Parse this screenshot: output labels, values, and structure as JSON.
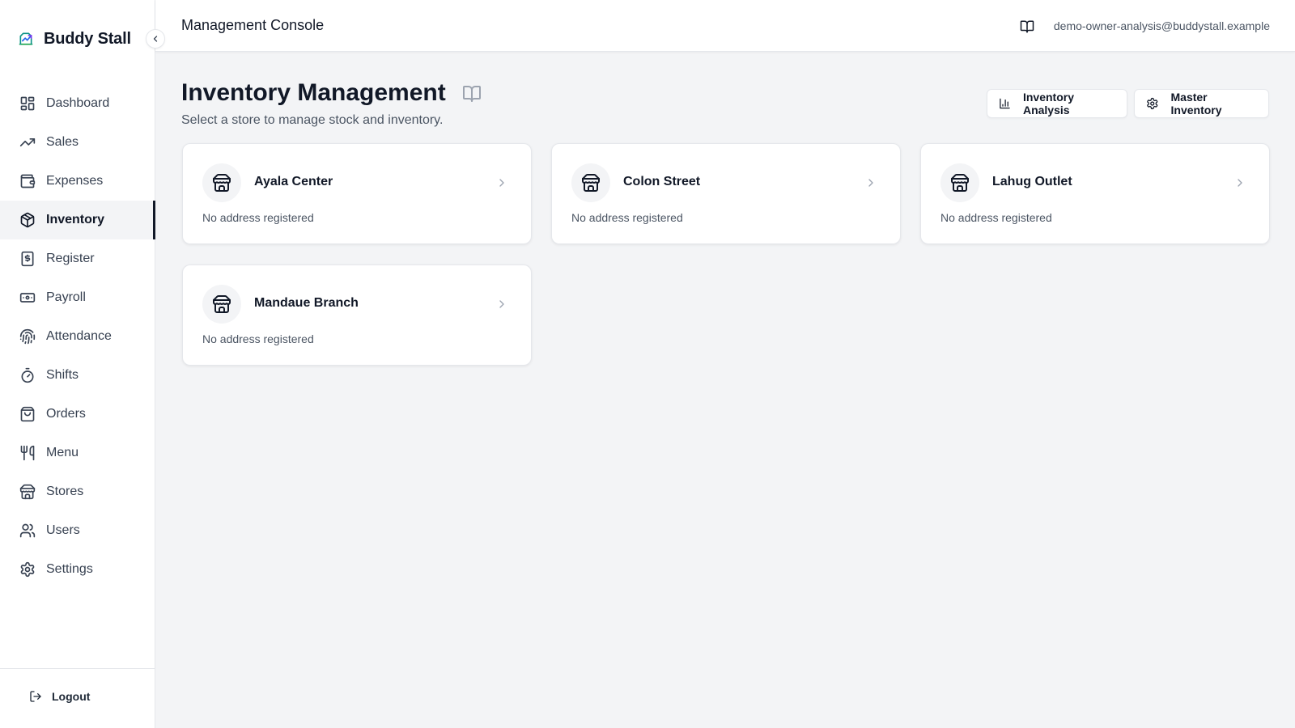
{
  "brand": {
    "name": "Buddy Stall"
  },
  "sidebar": {
    "items": [
      {
        "label": "Dashboard",
        "icon": "dashboard-icon"
      },
      {
        "label": "Sales",
        "icon": "trending-up-icon"
      },
      {
        "label": "Expenses",
        "icon": "wallet-icon"
      },
      {
        "label": "Inventory",
        "icon": "package-icon",
        "active": true
      },
      {
        "label": "Register",
        "icon": "receipt-icon"
      },
      {
        "label": "Payroll",
        "icon": "banknote-icon"
      },
      {
        "label": "Attendance",
        "icon": "fingerprint-icon"
      },
      {
        "label": "Shifts",
        "icon": "timer-icon"
      },
      {
        "label": "Orders",
        "icon": "shopping-bag-icon"
      },
      {
        "label": "Menu",
        "icon": "utensils-icon"
      },
      {
        "label": "Stores",
        "icon": "store-icon"
      },
      {
        "label": "Users",
        "icon": "users-icon"
      },
      {
        "label": "Settings",
        "icon": "gear-icon"
      }
    ],
    "logout_label": "Logout"
  },
  "header": {
    "title": "Management Console",
    "user_email": "demo-owner-analysis@buddystall.example"
  },
  "main": {
    "title": "Inventory Management",
    "subtitle": "Select a store to manage stock and inventory.",
    "actions": {
      "analysis_label": "Inventory Analysis",
      "master_label": "Master Inventory"
    },
    "stores": [
      {
        "name": "Ayala Center",
        "address": "No address registered"
      },
      {
        "name": "Colon Street",
        "address": "No address registered"
      },
      {
        "name": "Lahug Outlet",
        "address": "No address registered"
      },
      {
        "name": "Mandaue Branch",
        "address": "No address registered"
      }
    ]
  },
  "colors": {
    "accent": "#111827",
    "background": "#f3f4f6",
    "surface": "#ffffff",
    "border": "#e5e7eb",
    "muted_text": "#4b5563"
  }
}
